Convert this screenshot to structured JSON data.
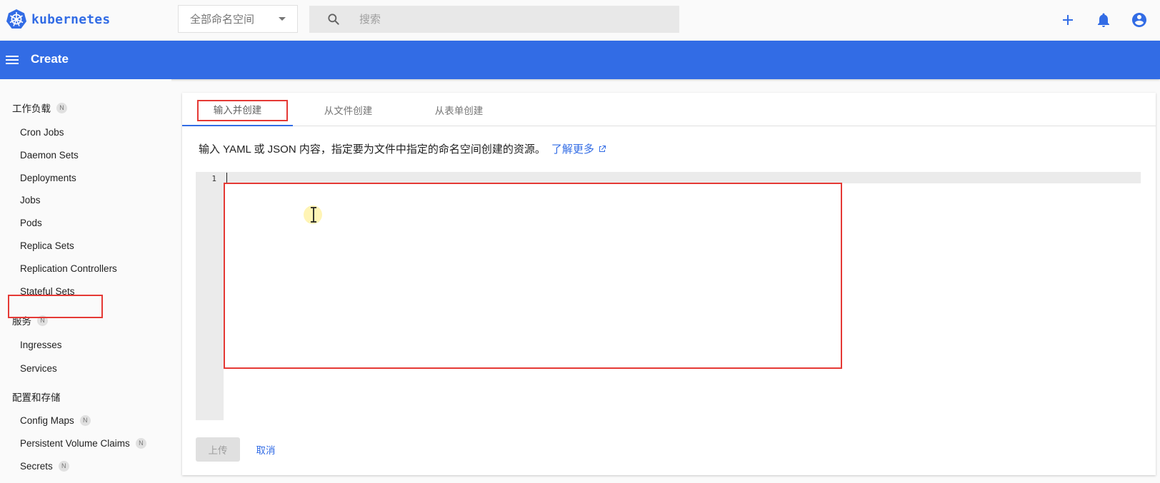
{
  "header": {
    "brand": "kubernetes",
    "namespace_select": {
      "value": "全部命名空间"
    },
    "search": {
      "placeholder": "搜索"
    },
    "icons": [
      "add-icon",
      "notifications-bell-icon",
      "account-circle-icon"
    ]
  },
  "toolbar": {
    "title": "Create"
  },
  "sidebar": {
    "workloads": {
      "label": "工作负载",
      "badge": "N"
    },
    "workload_items": [
      "Cron Jobs",
      "Daemon Sets",
      "Deployments",
      "Jobs",
      "Pods",
      "Replica Sets",
      "Replication Controllers",
      "Stateful Sets"
    ],
    "services": {
      "label": "服务",
      "badge": "N"
    },
    "service_items": [
      "Ingresses",
      "Services"
    ],
    "config": {
      "label": "配置和存储"
    },
    "config_items": [
      {
        "label": "Config Maps",
        "badge": "N"
      },
      {
        "label": "Persistent Volume Claims",
        "badge": "N"
      },
      {
        "label": "Secrets",
        "badge": "N"
      }
    ]
  },
  "main": {
    "tabs": [
      {
        "label": "输入并创建",
        "active": true
      },
      {
        "label": "从文件创建",
        "active": false
      },
      {
        "label": "从表单创建",
        "active": false
      }
    ],
    "description": "输入 YAML 或 JSON 内容，指定要为文件中指定的命名空间创建的资源。",
    "learn_more": "了解更多",
    "editor": {
      "line_number": "1",
      "content": ""
    },
    "upload_label": "上传",
    "cancel_label": "取消"
  },
  "colors": {
    "brand_blue": "#326ce5",
    "highlight_red": "#e53935"
  }
}
